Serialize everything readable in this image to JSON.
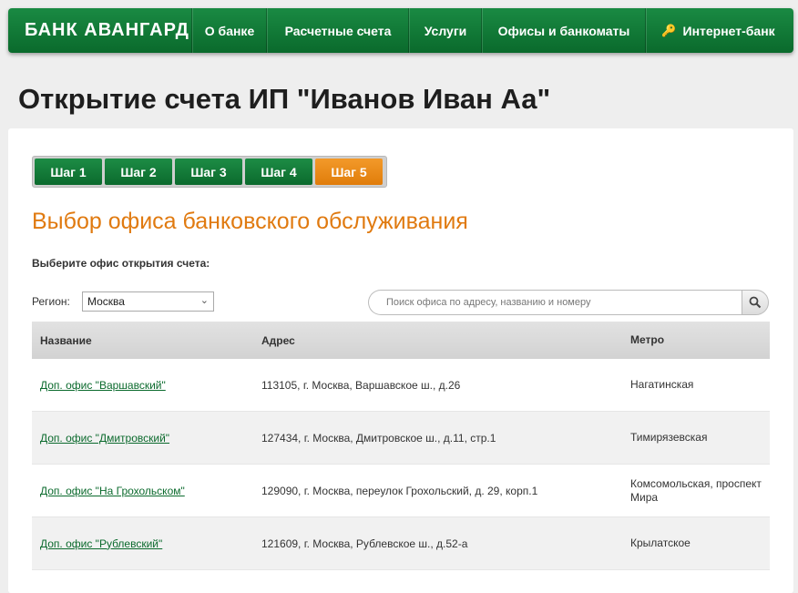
{
  "nav": {
    "logo": "БАНК АВАНГАРД",
    "items": [
      "О банке",
      "Расчетные счета",
      "Услуги",
      "Офисы и банкоматы"
    ],
    "internet_bank": "Интернет-банк"
  },
  "page": {
    "title": "Открытие счета ИП \"Иванов Иван Аа\""
  },
  "steps": [
    "Шаг 1",
    "Шаг 2",
    "Шаг 3",
    "Шаг 4",
    "Шаг 5"
  ],
  "active_step": 5,
  "section": {
    "title": "Выбор офиса банковского обслуживания",
    "instruction": "Выберите офис открытия счета:"
  },
  "region": {
    "label": "Регион:",
    "value": "Москва"
  },
  "search": {
    "placeholder": "Поиск офиса по адресу, названию и номеру"
  },
  "table": {
    "headers": [
      "Название",
      "Адрес",
      "Метро"
    ],
    "rows": [
      {
        "name": "Доп. офис \"Варшавский\"",
        "address": "113105, г. Москва, Варшавское ш., д.26",
        "metro": "Нагатинская"
      },
      {
        "name": "Доп. офис \"Дмитровский\"",
        "address": "127434, г. Москва, Дмитровское ш., д.11, стр.1",
        "metro": "Тимирязевская"
      },
      {
        "name": "Доп. офис \"На Грохольском\"",
        "address": "129090, г. Москва, переулок Грохольский, д. 29, корп.1",
        "metro": "Комсомольская, проспект Мира"
      },
      {
        "name": "Доп. офис \"Рублевский\"",
        "address": "121609, г. Москва, Рублевское ш., д.52-а",
        "metro": "Крылатское"
      }
    ]
  },
  "colors": {
    "brand_green": "#0f7a36",
    "accent_orange": "#e07a10"
  }
}
